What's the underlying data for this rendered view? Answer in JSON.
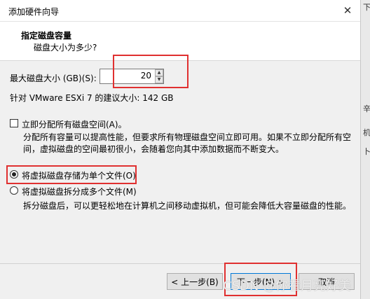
{
  "window": {
    "title": "添加硬件向导",
    "close_glyph": "✕"
  },
  "header": {
    "title": "指定磁盘容量",
    "subtitle": "磁盘大小为多少?"
  },
  "disk_size": {
    "label": "最大磁盘大小 (GB)(S):",
    "value": "20",
    "recommend_text": "针对 VMware ESXi 7 的建议大小: 142 GB"
  },
  "allocate": {
    "checkbox_label": "立即分配所有磁盘空间(A)。",
    "checked": false,
    "description_line1": "分配所有容量可以提高性能，但要求所有物理磁盘空间立即可用。如果不立即分配所有空",
    "description_line2": "间，虚拟磁盘的空间最初很小，会随着您向其中添加数据而不断变大。"
  },
  "storage": {
    "single_file_label": "将虚拟磁盘存储为单个文件(O)",
    "split_files_label": "将虚拟磁盘拆分成多个文件(M)",
    "selected": "single",
    "split_description": "拆分磁盘后，可以更轻松地在计算机之间移动虚拟机，但可能会降低大容量磁盘的性能。"
  },
  "buttons": {
    "back": "< 上一步(B)",
    "next": "下一步(N) >",
    "cancel": "取消"
  },
  "watermark": "CSDN @你看月亮好美",
  "background_fragments": [
    "下",
    "辛",
    "机",
    "卜"
  ],
  "colors": {
    "highlight_red": "#e03030",
    "focus_blue": "#0078d7"
  }
}
